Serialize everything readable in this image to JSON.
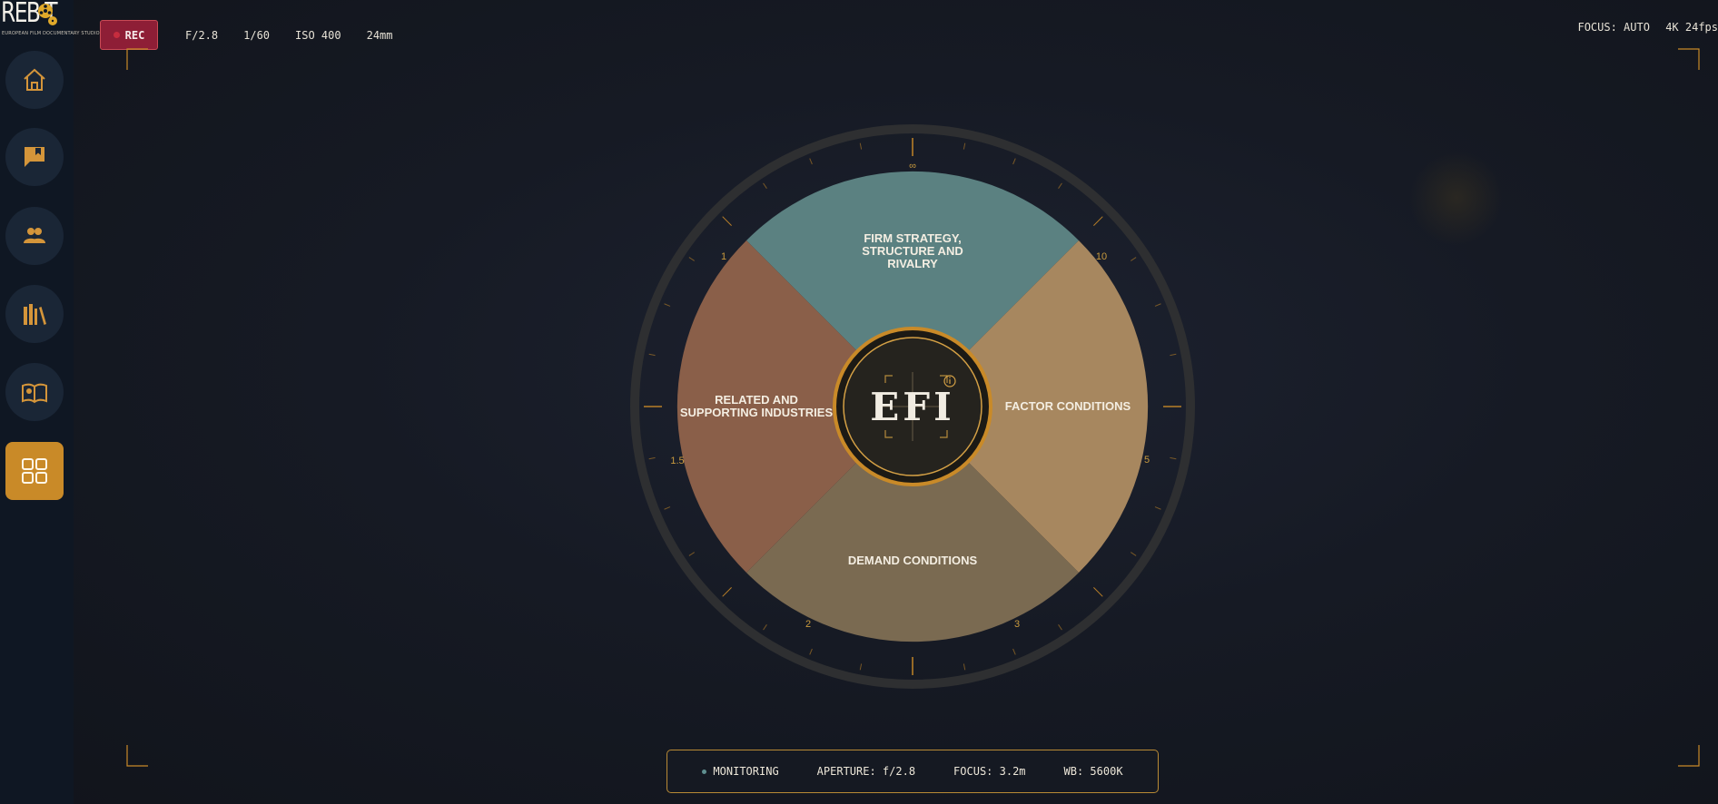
{
  "brand": {
    "logo_text": "REB T",
    "logo_tagline": "EUROPEAN FILM DOCUMENTARY STUDIOS"
  },
  "sidebar": {
    "items": [
      {
        "name": "home",
        "icon": "home-icon"
      },
      {
        "name": "messages",
        "icon": "bookmark-chat-icon"
      },
      {
        "name": "team",
        "icon": "people-icon"
      },
      {
        "name": "library",
        "icon": "books-icon"
      },
      {
        "name": "reading",
        "icon": "open-book-icon"
      },
      {
        "name": "dashboard",
        "icon": "grid-icon",
        "active": true
      }
    ]
  },
  "camera": {
    "rec_label": "REC",
    "aperture": "F/2.8",
    "shutter": "1/60",
    "iso": "ISO 400",
    "focal": "24mm",
    "focus_mode": "FOCUS: AUTO",
    "format": "4K 24fps"
  },
  "dial": {
    "center_label": "EFI",
    "segments": {
      "top": [
        "FIRM STRATEGY,",
        "STRUCTURE AND",
        "RIVALRY"
      ],
      "right": [
        "FACTOR CONDITIONS"
      ],
      "bottom": [
        "DEMAND CONDITIONS"
      ],
      "left": [
        "RELATED AND",
        "SUPPORTING INDUSTRIES"
      ]
    },
    "ticks": {
      "infinity": "∞",
      "ten": "10",
      "five": "5",
      "three": "3",
      "two": "2",
      "one_five": "1.5",
      "one": "1"
    }
  },
  "status_bar": {
    "monitoring": "MONITORING",
    "aperture": "APERTURE: f/2.8",
    "focus": "FOCUS: 3.2m",
    "wb": "WB: 5600K"
  },
  "colors": {
    "accent": "#c98a28",
    "top_segment": "#5b8181",
    "right_segment": "#a7875f",
    "bottom_segment": "#7a6a51",
    "left_segment": "#8a5f49",
    "rec": "#8e1e36"
  }
}
